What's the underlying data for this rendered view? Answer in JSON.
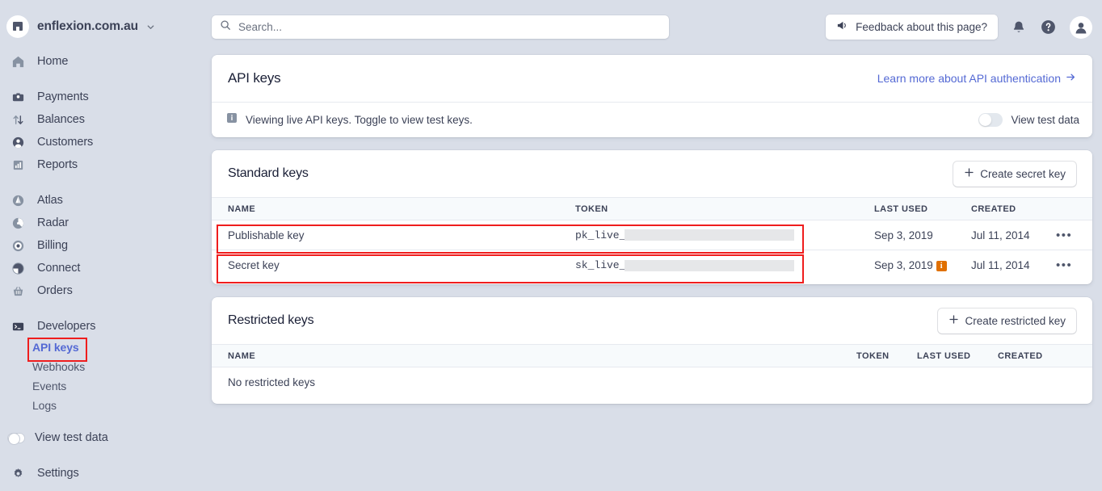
{
  "colors": {
    "sidebar_bg": "#d9dee8",
    "accent": "#5469d4",
    "highlight": "#ef1d1d",
    "card_bg": "#ffffff",
    "warning": "#e07000"
  },
  "sidebar": {
    "brand": {
      "name": "enflexion.com.au",
      "icon": "store-icon",
      "caret": "chevron-down-icon"
    },
    "groups": [
      {
        "items": [
          {
            "label": "Home",
            "icon": "home-icon"
          }
        ]
      },
      {
        "items": [
          {
            "label": "Payments",
            "icon": "payments-icon"
          },
          {
            "label": "Balances",
            "icon": "balances-icon"
          },
          {
            "label": "Customers",
            "icon": "customers-icon"
          },
          {
            "label": "Reports",
            "icon": "reports-icon"
          }
        ]
      },
      {
        "items": [
          {
            "label": "Atlas",
            "icon": "atlas-icon"
          },
          {
            "label": "Radar",
            "icon": "radar-icon"
          },
          {
            "label": "Billing",
            "icon": "billing-icon"
          },
          {
            "label": "Connect",
            "icon": "connect-icon"
          },
          {
            "label": "Orders",
            "icon": "orders-icon"
          }
        ]
      },
      {
        "items": [
          {
            "label": "Developers",
            "icon": "developers-icon"
          }
        ]
      }
    ],
    "developers_sub": [
      {
        "label": "API keys",
        "active": true
      },
      {
        "label": "Webhooks",
        "active": false
      },
      {
        "label": "Events",
        "active": false
      },
      {
        "label": "Logs",
        "active": false
      }
    ],
    "view_test_data": {
      "label": "View test data",
      "on": false
    },
    "settings": {
      "label": "Settings",
      "icon": "gear-icon"
    }
  },
  "topbar": {
    "search": {
      "placeholder": "Search...",
      "value": "",
      "icon": "search-icon"
    },
    "feedback": {
      "label": "Feedback about this page?",
      "icon": "megaphone-icon"
    },
    "notifications_icon": "bell-icon",
    "help_icon": "help-circle-icon",
    "avatar_icon": "user-avatar-icon"
  },
  "api_keys_card": {
    "title": "API keys",
    "learn_more": "Learn more about API authentication",
    "learn_more_icon": "arrow-right-icon",
    "banner": {
      "icon": "info-icon",
      "text": "Viewing live API keys. Toggle to view test keys.",
      "toggle_label": "View test data",
      "toggle_on": false
    }
  },
  "standard_keys": {
    "title": "Standard keys",
    "create_button": {
      "label": "Create secret key",
      "icon": "plus-icon"
    },
    "columns": [
      "NAME",
      "TOKEN",
      "LAST USED",
      "CREATED"
    ],
    "rows": [
      {
        "name": "Publishable key",
        "token_prefix": "pk_live_",
        "token_masked": true,
        "last_used": "Sep 3, 2019",
        "warning": false,
        "created": "Jul 11, 2014",
        "menu": "overflow-menu-icon"
      },
      {
        "name": "Secret key",
        "token_prefix": "sk_live_",
        "token_masked": true,
        "last_used": "Sep 3, 2019",
        "warning": true,
        "warning_icon": "orange-info-icon",
        "created": "Jul 11, 2014",
        "menu": "overflow-menu-icon"
      }
    ]
  },
  "restricted_keys": {
    "title": "Restricted keys",
    "create_button": {
      "label": "Create restricted key",
      "icon": "plus-icon"
    },
    "columns": [
      "NAME",
      "TOKEN",
      "LAST USED",
      "CREATED"
    ],
    "empty_text": "No restricted keys"
  }
}
